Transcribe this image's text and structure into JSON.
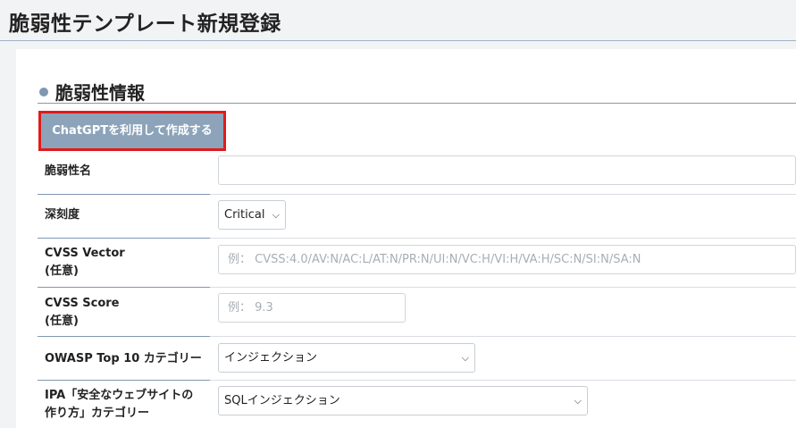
{
  "page": {
    "title": "脆弱性テンプレート新規登録"
  },
  "section": {
    "title": "脆弱性情報"
  },
  "ai_button": {
    "label": "ChatGPTを利用して作成する"
  },
  "fields": {
    "name": {
      "label": "脆弱性名",
      "value": ""
    },
    "severity": {
      "label": "深刻度",
      "selected": "Critical"
    },
    "cvss_vector": {
      "label_line1": "CVSS Vector",
      "label_line2": "(任意)",
      "placeholder": "例： CVSS:4.0/AV:N/AC:L/AT:N/PR:N/UI:N/VC:H/VI:H/VA:H/SC:N/SI:N/SA:N"
    },
    "cvss_score": {
      "label_line1": "CVSS Score",
      "label_line2": "(任意)",
      "placeholder": "例： 9.3"
    },
    "owasp": {
      "label": "OWASP Top 10 カテゴリー",
      "selected": "インジェクション"
    },
    "ipa": {
      "label_line1": "IPA「安全なウェブサイトの",
      "label_line2": "作り方」カテゴリー",
      "selected": "SQLインジェクション"
    }
  },
  "icons": {
    "select_arrow": "chevron-down-icon",
    "section_bullet": "bullet-icon"
  },
  "colors": {
    "highlight": "#e21a1a",
    "button_bg": "#8ca3b9",
    "accent": "#7f98b0"
  }
}
